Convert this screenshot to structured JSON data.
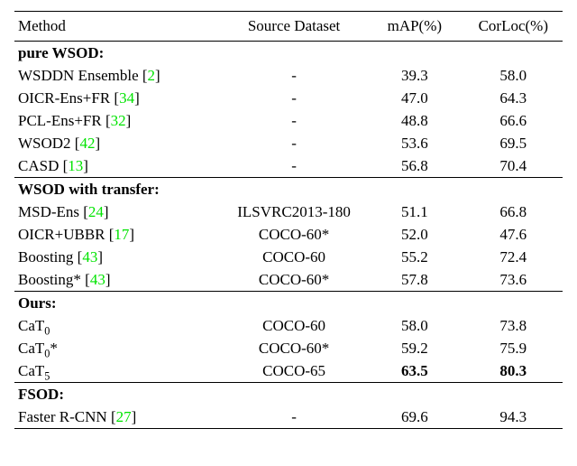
{
  "headers": {
    "method": "Method",
    "source": "Source Dataset",
    "map": "mAP(%)",
    "corloc": "CorLoc(%)"
  },
  "sections": [
    {
      "label": "pure WSOD:",
      "rows": [
        {
          "method_pre": "WSDDN Ensemble [",
          "cite": "2",
          "method_post": "]",
          "source": "-",
          "map": "39.3",
          "corloc": "58.0"
        },
        {
          "method_pre": "OICR-Ens+FR [",
          "cite": "34",
          "method_post": "]",
          "source": "-",
          "map": "47.0",
          "corloc": "64.3"
        },
        {
          "method_pre": "PCL-Ens+FR [",
          "cite": "32",
          "method_post": "]",
          "source": "-",
          "map": "48.8",
          "corloc": "66.6"
        },
        {
          "method_pre": "WSOD2 [",
          "cite": "42",
          "method_post": "]",
          "source": "-",
          "map": "53.6",
          "corloc": "69.5"
        },
        {
          "method_pre": "CASD [",
          "cite": "13",
          "method_post": "]",
          "source": "-",
          "map": "56.8",
          "corloc": "70.4"
        }
      ]
    },
    {
      "label": "WSOD with transfer:",
      "rows": [
        {
          "method_pre": "MSD-Ens [",
          "cite": "24",
          "method_post": "]",
          "source": "ILSVRC2013-180",
          "map": "51.1",
          "corloc": "66.8"
        },
        {
          "method_pre": "OICR+UBBR [",
          "cite": "17",
          "method_post": "]",
          "source": "COCO-60*",
          "map": "52.0",
          "corloc": "47.6"
        },
        {
          "method_pre": "Boosting [",
          "cite": "43",
          "method_post": "]",
          "source": "COCO-60",
          "map": "55.2",
          "corloc": "72.4"
        },
        {
          "method_pre": "Boosting* [",
          "cite": "43",
          "method_post": "]",
          "source": "COCO-60*",
          "map": "57.8",
          "corloc": "73.6"
        }
      ]
    },
    {
      "label": "Ours:",
      "rows": [
        {
          "method_html": "CaT<sub>0</sub>",
          "source": "COCO-60",
          "map": "58.0",
          "corloc": "73.8"
        },
        {
          "method_html": "CaT<sub>0</sub>*",
          "source": "COCO-60*",
          "map": "59.2",
          "corloc": "75.9"
        },
        {
          "method_html": "CaT<sub>5</sub>",
          "source": "COCO-65",
          "map": "63.5",
          "corloc": "80.3",
          "bold": true
        }
      ]
    },
    {
      "label": "FSOD:",
      "rows": [
        {
          "method_pre": "Faster R-CNN [",
          "cite": "27",
          "method_post": "]",
          "source": "-",
          "map": "69.6",
          "corloc": "94.3"
        }
      ]
    }
  ],
  "chart_data": {
    "type": "table",
    "title": "",
    "columns": [
      "Method",
      "Source Dataset",
      "mAP(%)",
      "CorLoc(%)"
    ],
    "sections": [
      {
        "name": "pure WSOD",
        "rows": [
          [
            "WSDDN Ensemble [2]",
            "-",
            39.3,
            58.0
          ],
          [
            "OICR-Ens+FR [34]",
            "-",
            47.0,
            64.3
          ],
          [
            "PCL-Ens+FR [32]",
            "-",
            48.8,
            66.6
          ],
          [
            "WSOD2 [42]",
            "-",
            53.6,
            69.5
          ],
          [
            "CASD [13]",
            "-",
            56.8,
            70.4
          ]
        ]
      },
      {
        "name": "WSOD with transfer",
        "rows": [
          [
            "MSD-Ens [24]",
            "ILSVRC2013-180",
            51.1,
            66.8
          ],
          [
            "OICR+UBBR [17]",
            "COCO-60*",
            52.0,
            47.6
          ],
          [
            "Boosting [43]",
            "COCO-60",
            55.2,
            72.4
          ],
          [
            "Boosting* [43]",
            "COCO-60*",
            57.8,
            73.6
          ]
        ]
      },
      {
        "name": "Ours",
        "rows": [
          [
            "CaT_0",
            "COCO-60",
            58.0,
            73.8
          ],
          [
            "CaT_0*",
            "COCO-60*",
            59.2,
            75.9
          ],
          [
            "CaT_5",
            "COCO-65",
            63.5,
            80.3
          ]
        ]
      },
      {
        "name": "FSOD",
        "rows": [
          [
            "Faster R-CNN [27]",
            "-",
            69.6,
            94.3
          ]
        ]
      }
    ]
  }
}
